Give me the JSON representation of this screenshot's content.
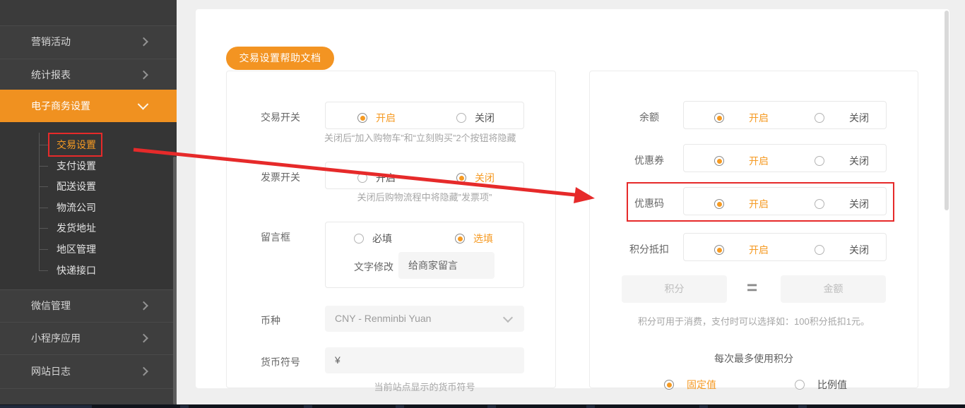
{
  "colors": {
    "orange": "#f29320",
    "red": "#e62a2a",
    "sidebar_bg": "#3e3e3e"
  },
  "sidebar": {
    "menu_top": [
      {
        "label": "营销活动"
      },
      {
        "label": "统计报表"
      }
    ],
    "active_item": {
      "label": "电子商务设置"
    },
    "submenu": [
      {
        "label": "交易设置"
      },
      {
        "label": "支付设置"
      },
      {
        "label": "配送设置"
      },
      {
        "label": "物流公司"
      },
      {
        "label": "发货地址"
      },
      {
        "label": "地区管理"
      },
      {
        "label": "快递接口"
      }
    ],
    "menu_bottom": [
      {
        "label": "微信管理"
      },
      {
        "label": "小程序应用"
      },
      {
        "label": "网站日志"
      }
    ]
  },
  "toolbar": {
    "help_button": "交易设置帮助文档"
  },
  "left_panel": {
    "trade": {
      "label": "交易开关",
      "on": "开启",
      "off": "关闭",
      "hint": "关闭后“加入购物车”和“立刻购买”2个按钮将隐藏"
    },
    "invoice": {
      "label": "发票开关",
      "on": "开启",
      "off": "关闭",
      "hint": "关闭后购物流程中将隐藏”发票项”"
    },
    "message": {
      "label": "留言框",
      "required": "必填",
      "optional": "选填",
      "edit_label": "文字修改",
      "edit_value": "给商家留言"
    },
    "currency": {
      "label": "币种",
      "value": "CNY - Renminbi Yuan"
    },
    "symbol": {
      "label": "货币符号",
      "value": "¥",
      "hint": "当前站点显示的货币符号"
    }
  },
  "right_panel": {
    "rows": [
      {
        "label": "余额",
        "on": "开启",
        "off": "关闭"
      },
      {
        "label": "优惠券",
        "on": "开启",
        "off": "关闭"
      },
      {
        "label": "优惠码",
        "on": "开启",
        "off": "关闭"
      },
      {
        "label": "积分抵扣",
        "on": "开启",
        "off": "关闭"
      }
    ],
    "points": {
      "points_placeholder": "积分",
      "equals": "=",
      "amount_placeholder": "金额",
      "hint": "积分可用于消费，支付时可以选择如：100积分抵扣1元。",
      "max_label": "每次最多使用积分",
      "fixed": "固定值",
      "ratio": "比例值"
    }
  }
}
